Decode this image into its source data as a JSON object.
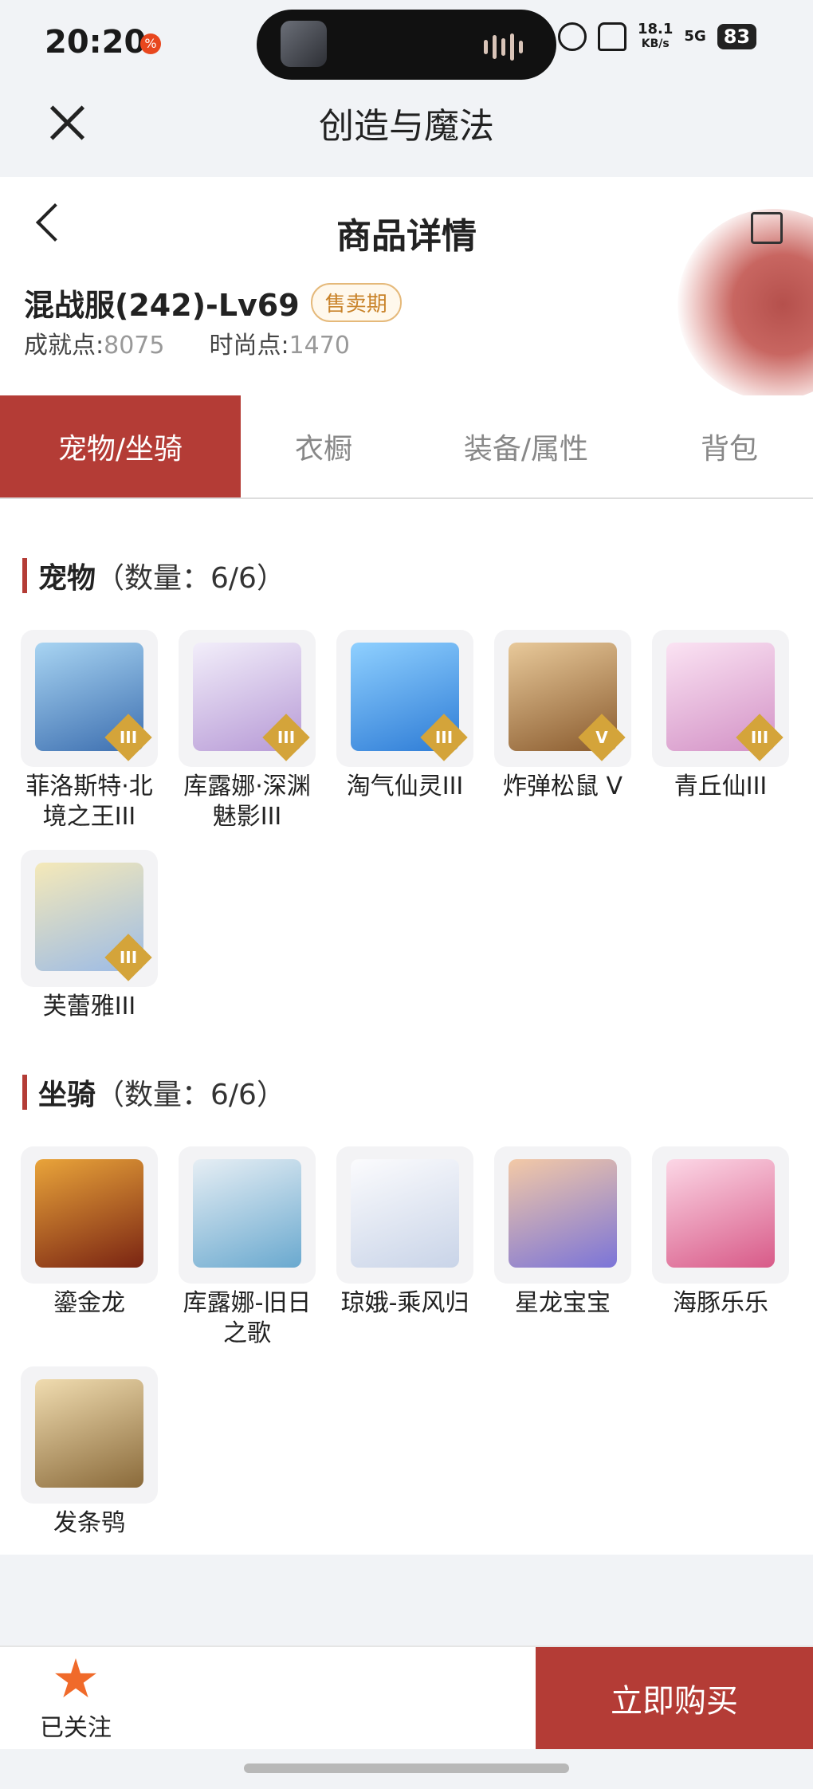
{
  "status_bar": {
    "time": "20:20",
    "net_speed_top": "18.1",
    "net_speed_bottom": "KB/s",
    "network": "5G",
    "battery": "83"
  },
  "app": {
    "title": "创造与魔法"
  },
  "product": {
    "title": "商品详情",
    "server": "混战服(242)-Lv69",
    "status_badge": "售卖期",
    "achievement_label": "成就点:",
    "achievement_value": "8075",
    "fashion_label": "时尚点:",
    "fashion_value": "1470"
  },
  "tabs": [
    {
      "label": "宠物/坐骑",
      "active": true
    },
    {
      "label": "衣橱",
      "active": false
    },
    {
      "label": "装备/属性",
      "active": false
    },
    {
      "label": "背包",
      "active": false
    }
  ],
  "pets": {
    "title": "宠物",
    "count": "（数量：6/6）",
    "items": [
      {
        "name": "菲洛斯特·北境之王III",
        "tier": "III",
        "color": "#4c86c8"
      },
      {
        "name": "库露娜·深渊魅影III",
        "tier": "III",
        "color": "#c9b4e6"
      },
      {
        "name": "淘气仙灵III",
        "tier": "III",
        "color": "#3f93e0"
      },
      {
        "name": "炸弹松鼠 V",
        "tier": "V",
        "color": "#b8864e"
      },
      {
        "name": "青丘仙III",
        "tier": "III",
        "color": "#e7a9d8"
      },
      {
        "name": "芙蕾雅III",
        "tier": "III",
        "color": "#a7c6ec"
      }
    ]
  },
  "mounts": {
    "title": "坐骑",
    "count": "（数量：6/6）",
    "items": [
      {
        "name": "鎏金龙",
        "color": "#b3431c"
      },
      {
        "name": "库露娜-旧日之歌",
        "color": "#8fc4de"
      },
      {
        "name": "琼娥-乘风归",
        "color": "#e2e8f2"
      },
      {
        "name": "星龙宝宝",
        "color": "#8d86e0"
      },
      {
        "name": "海豚乐乐",
        "color": "#e88ab2"
      },
      {
        "name": "发条鸮",
        "color": "#c79a52"
      }
    ]
  },
  "bottom": {
    "follow_label": "已关注",
    "buy_label": "立即购买"
  }
}
